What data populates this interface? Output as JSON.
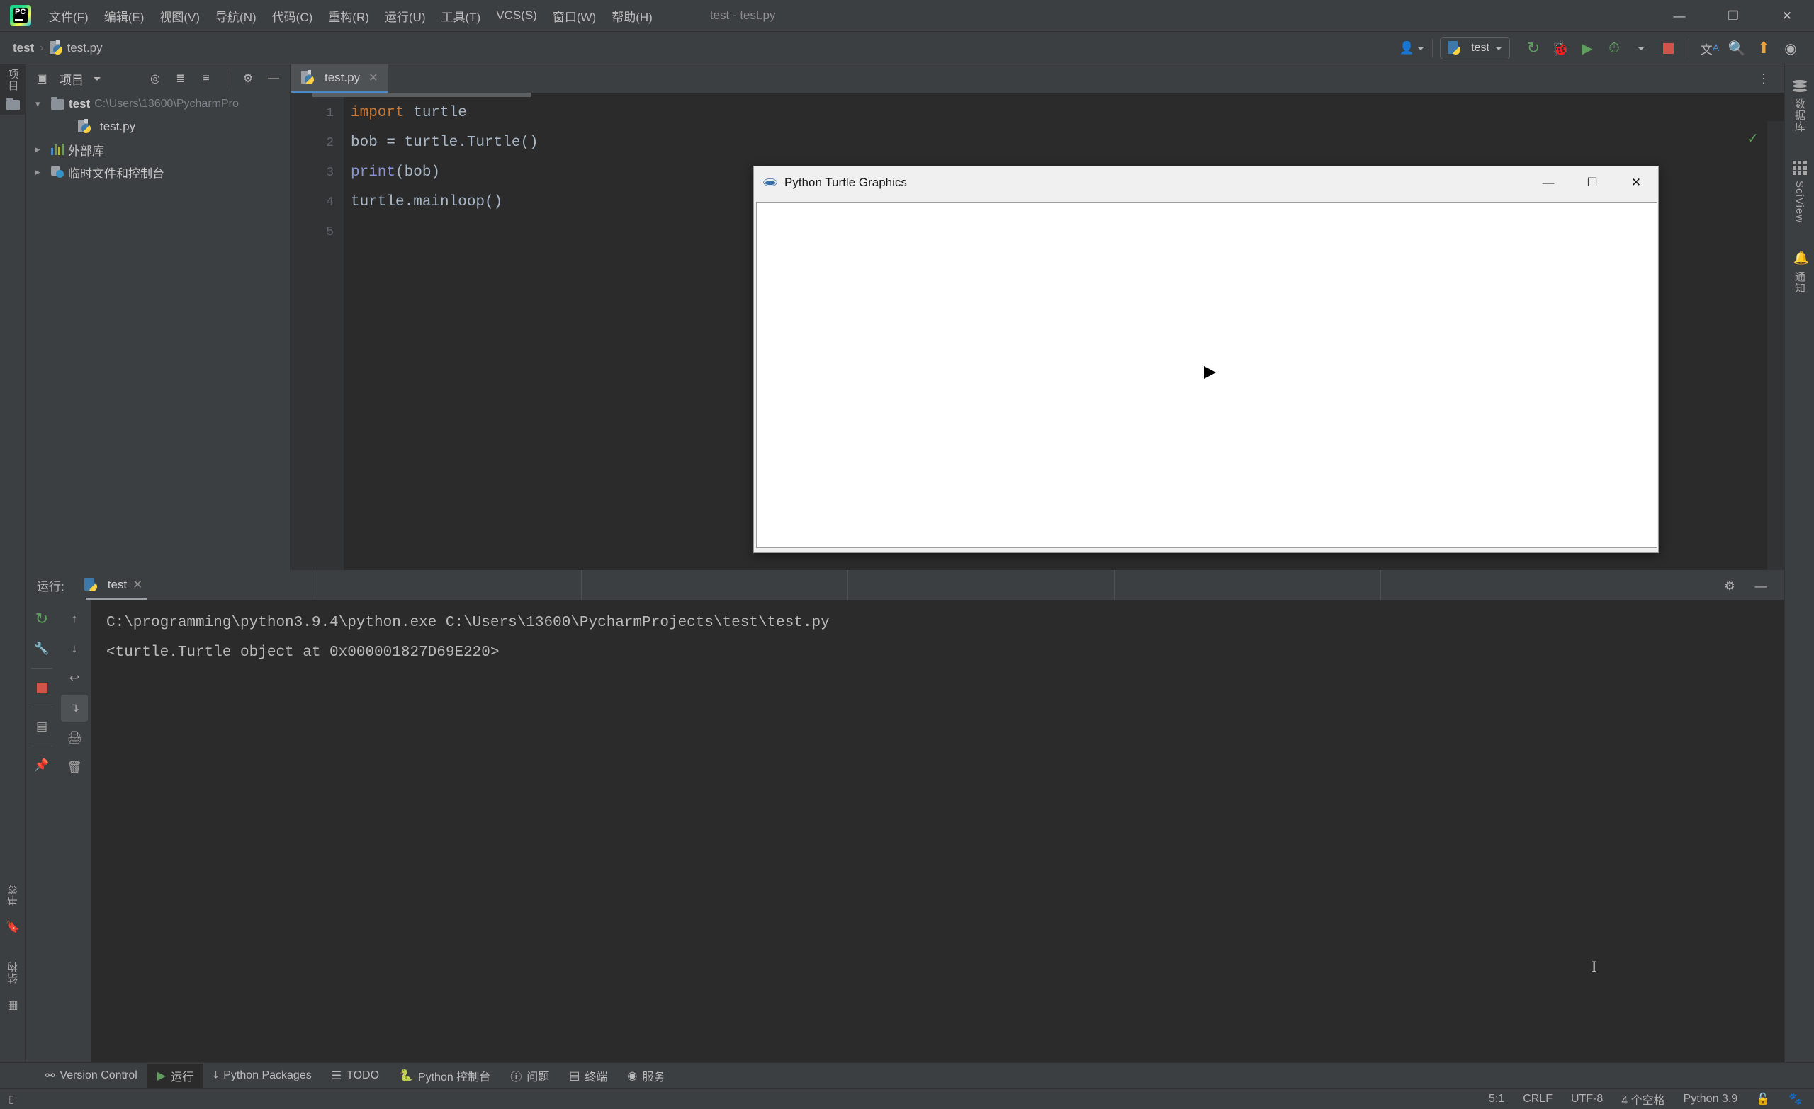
{
  "window": {
    "title": "test - test.py",
    "minimize_label": "—",
    "maximize_label": "❐",
    "close_label": "✕"
  },
  "menubar": {
    "logo_text": "PC",
    "items": [
      {
        "label": "文件(F)"
      },
      {
        "label": "编辑(E)"
      },
      {
        "label": "视图(V)"
      },
      {
        "label": "导航(N)"
      },
      {
        "label": "代码(C)"
      },
      {
        "label": "重构(R)"
      },
      {
        "label": "运行(U)"
      },
      {
        "label": "工具(T)"
      },
      {
        "label": "VCS(S)"
      },
      {
        "label": "窗口(W)"
      },
      {
        "label": "帮助(H)"
      }
    ]
  },
  "navbar": {
    "breadcrumb_root": "test",
    "breadcrumb_sep": "›",
    "breadcrumb_file": "test.py",
    "run_config": "test",
    "icons": {
      "account": "account-icon",
      "rerun": "rerun-icon",
      "debug": "debug-icon",
      "coverage": "coverage-icon",
      "profile": "profile-icon",
      "stop": "stop-icon",
      "translate": "translate-icon",
      "search": "search-icon",
      "update": "update-icon",
      "plugin": "plugin-icon"
    }
  },
  "left_strip": {
    "project_label": "项目",
    "bookmarks_label": "书签",
    "structure_label": "结构"
  },
  "right_strip": {
    "database_label": "数据库",
    "sciview_label": "SciView",
    "notifications_label": "通知"
  },
  "project_panel": {
    "title": "项目",
    "tree": [
      {
        "label": "test",
        "detail": "C:\\Users\\13600\\PycharmPro",
        "expanded": true,
        "level": 1,
        "icon": "folder-icon"
      },
      {
        "label": "test.py",
        "detail": "",
        "expanded": null,
        "level": 2,
        "icon": "python-file-icon"
      },
      {
        "label": "外部库",
        "detail": "",
        "expanded": false,
        "level": 1,
        "icon": "library-icon"
      },
      {
        "label": "临时文件和控制台",
        "detail": "",
        "expanded": false,
        "level": 1,
        "icon": "scratch-icon"
      }
    ]
  },
  "editor": {
    "tab_label": "test.py",
    "tab_close": "✕",
    "line_numbers": [
      "1",
      "2",
      "3",
      "4",
      "5"
    ],
    "lines": [
      {
        "tokens": [
          {
            "t": "import",
            "c": "kw"
          },
          {
            "t": " turtle",
            "c": ""
          }
        ]
      },
      {
        "tokens": [
          {
            "t": "bob = turtle.Turtle()",
            "c": ""
          }
        ]
      },
      {
        "tokens": [
          {
            "t": "print",
            "c": "fn"
          },
          {
            "t": "(bob)",
            "c": ""
          }
        ]
      },
      {
        "tokens": [
          {
            "t": "turtle.mainloop()",
            "c": ""
          }
        ]
      },
      {
        "tokens": [
          {
            "t": "",
            "c": ""
          }
        ]
      }
    ],
    "inspection_status": "✓"
  },
  "turtle_window": {
    "title": "Python Turtle Graphics",
    "minimize_label": "—",
    "maximize_label": "☐",
    "close_label": "✕",
    "cursor": "turtle-arrow"
  },
  "run_window": {
    "label": "运行:",
    "tab_label": "test",
    "tab_close": "✕",
    "console_lines": [
      "C:\\programming\\python3.9.4\\python.exe C:\\Users\\13600\\PycharmProjects\\test\\test.py",
      "<turtle.Turtle object at 0x000001827D69E220>"
    ],
    "tool_icons_col1": [
      "rerun-icon",
      "wrench-icon",
      "stop-icon",
      "layout-icon",
      "pin-icon"
    ],
    "tool_icons_col2": [
      "arrow-up-icon",
      "arrow-down-icon",
      "soft-wrap-icon",
      "scroll-end-icon",
      "print-icon",
      "trash-icon"
    ]
  },
  "bottom_tabs": [
    {
      "label": "Version Control",
      "icon": "branch-icon",
      "active": false
    },
    {
      "label": "运行",
      "icon": "run-icon",
      "active": true
    },
    {
      "label": "Python Packages",
      "icon": "packages-icon",
      "active": false
    },
    {
      "label": "TODO",
      "icon": "todo-icon",
      "active": false
    },
    {
      "label": "Python 控制台",
      "icon": "python-console-icon",
      "active": false
    },
    {
      "label": "问题",
      "icon": "problems-icon",
      "active": false
    },
    {
      "label": "终端",
      "icon": "terminal-icon",
      "active": false
    },
    {
      "label": "服务",
      "icon": "services-icon",
      "active": false
    }
  ],
  "statusbar": {
    "caret_position": "5:1",
    "line_separator": "CRLF",
    "encoding": "UTF-8",
    "indent": "4 个空格",
    "interpreter": "Python 3.9",
    "lock_icon": "unlock-icon",
    "extra_icon": "baidu-icon"
  }
}
